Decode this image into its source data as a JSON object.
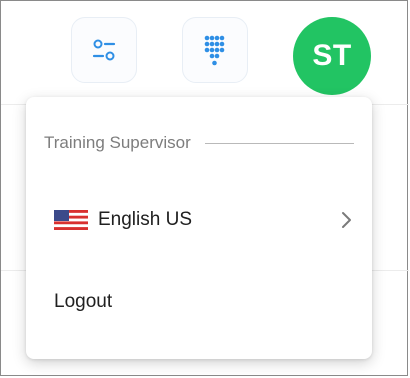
{
  "header": {
    "filter_button_icon": "sliders-icon",
    "dialpad_button_icon": "dialpad-icon",
    "avatar_initials": "ST",
    "avatar_color": "#22c463",
    "accent_color": "#2f8fe5"
  },
  "menu": {
    "role_label": "Training Supervisor",
    "language": {
      "flag_icon": "us-flag-icon",
      "label": "English US"
    },
    "logout_label": "Logout"
  }
}
